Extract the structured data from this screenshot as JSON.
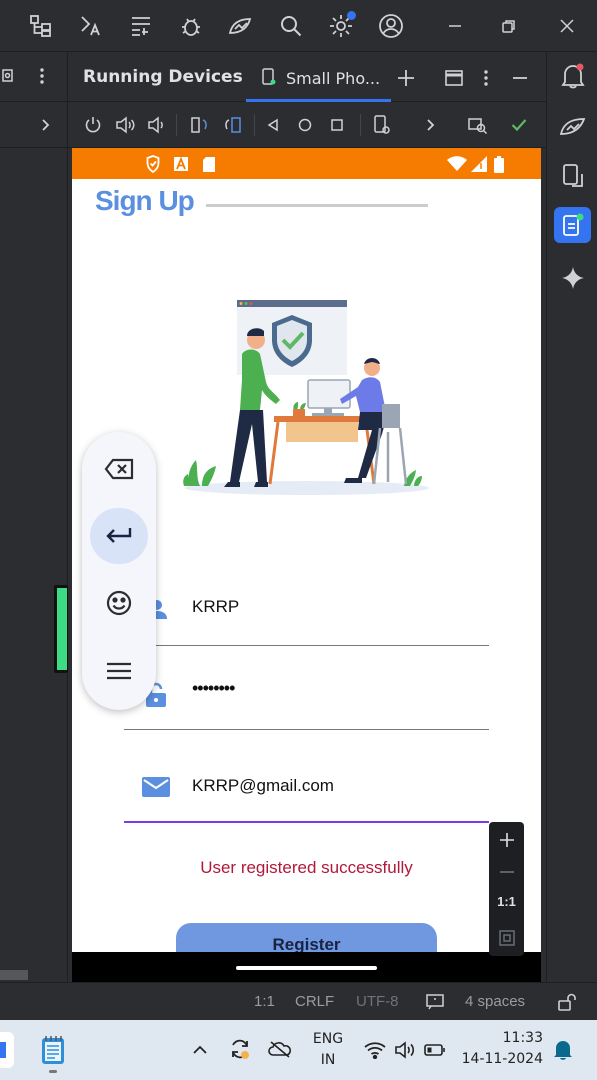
{
  "panel": {
    "title": "Running Devices",
    "device_tab": "Small Pho..."
  },
  "app": {
    "heading": "Sign Up",
    "username": "KRRP",
    "password": "••••••••",
    "email": "KRRP@gmail.com",
    "status_message": "User registered successfully",
    "register_button": "Register"
  },
  "zoom": {
    "one_to_one": "1:1"
  },
  "status_footer": {
    "position": "1:1",
    "line_ending": "CRLF",
    "encoding": "UTF-8",
    "indent": "4 spaces"
  },
  "taskbar": {
    "language_top": "ENG",
    "language_bottom": "IN",
    "time": "11:33",
    "date": "14-11-2024"
  },
  "colors": {
    "status_bar": "#f57c00",
    "heading": "#5b8fe0",
    "accent_underline": "#7c3aed",
    "success_text": "#b0193a",
    "register_button": "#6f98e0",
    "selected_tool": "#3574f0"
  }
}
